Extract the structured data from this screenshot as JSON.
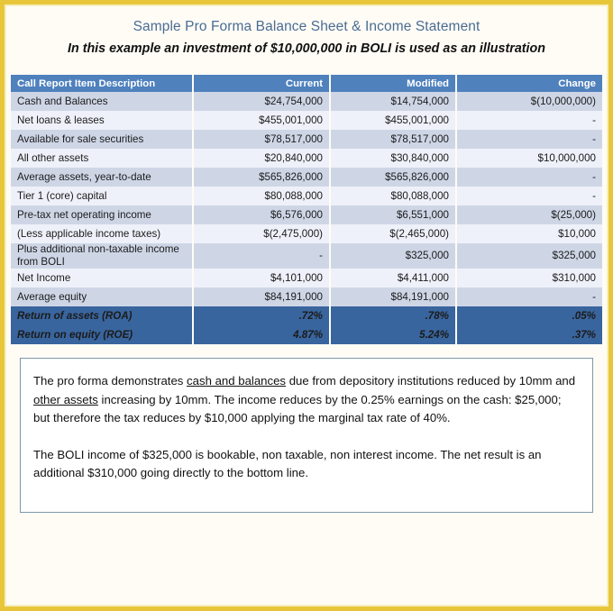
{
  "document": {
    "title": "Sample Pro Forma Balance Sheet & Income Statement",
    "subtitle": "In this example an investment of $10,000,000 in BOLI is used as an illustration",
    "accent_border_color": "#e8c63a",
    "header_color": "#4f81bd",
    "total_row_color": "#39659e",
    "title_color": "#4a6c92"
  },
  "table": {
    "columns": [
      {
        "key": "description",
        "label": "Call Report Item Description",
        "align": "left"
      },
      {
        "key": "current",
        "label": "Current",
        "align": "right"
      },
      {
        "key": "modified",
        "label": "Modified",
        "align": "right"
      },
      {
        "key": "change",
        "label": "Change",
        "align": "right"
      }
    ],
    "rows": [
      {
        "description": "Cash and Balances",
        "current": "$24,754,000",
        "modified": "$14,754,000",
        "change": "$(10,000,000)"
      },
      {
        "description": "Net loans & leases",
        "current": "$455,001,000",
        "modified": "$455,001,000",
        "change": "-"
      },
      {
        "description": "Available for sale securities",
        "current": "$78,517,000",
        "modified": "$78,517,000",
        "change": "-"
      },
      {
        "description": "All other assets",
        "current": "$20,840,000",
        "modified": "$30,840,000",
        "change": "$10,000,000"
      },
      {
        "description": "Average assets, year-to-date",
        "current": "$565,826,000",
        "modified": "$565,826,000",
        "change": "-"
      },
      {
        "description": "Tier 1 (core) capital",
        "current": "$80,088,000",
        "modified": "$80,088,000",
        "change": "-"
      },
      {
        "description": "Pre-tax net operating income",
        "current": "$6,576,000",
        "modified": "$6,551,000",
        "change": "$(25,000)"
      },
      {
        "description": "(Less applicable income taxes)",
        "current": "$(2,475,000)",
        "modified": "$(2,465,000)",
        "change": "$10,000"
      },
      {
        "description": "Plus additional non-taxable income from BOLI",
        "current": "-",
        "modified": "$325,000",
        "change": "$325,000"
      },
      {
        "description": "Net Income",
        "current": "$4,101,000",
        "modified": "$4,411,000",
        "change": "$310,000"
      },
      {
        "description": "Average equity",
        "current": "$84,191,000",
        "modified": "$84,191,000",
        "change": "-"
      }
    ],
    "total_rows": [
      {
        "description": "Return of assets (ROA)",
        "current": ".72%",
        "modified": ".78%",
        "change": ".05%"
      },
      {
        "description": "Return on equity (ROE)",
        "current": "4.87%",
        "modified": "5.24%",
        "change": ".37%"
      }
    ]
  },
  "note": {
    "paragraph1_part1": "The pro forma demonstrates ",
    "paragraph1_underline1": "cash and balances",
    "paragraph1_part2": " due from depository institutions reduced by 10mm and ",
    "paragraph1_underline2": "other assets",
    "paragraph1_part3": " increasing by 10mm.  The income reduces by the 0.25% earnings on the cash:  $25,000; but therefore the tax reduces by $10,000 applying the marginal tax rate of 40%.",
    "paragraph2": "The BOLI income of $325,000 is bookable, non taxable, non interest income.  The net result is an additional $310,000 going directly to the bottom line."
  }
}
